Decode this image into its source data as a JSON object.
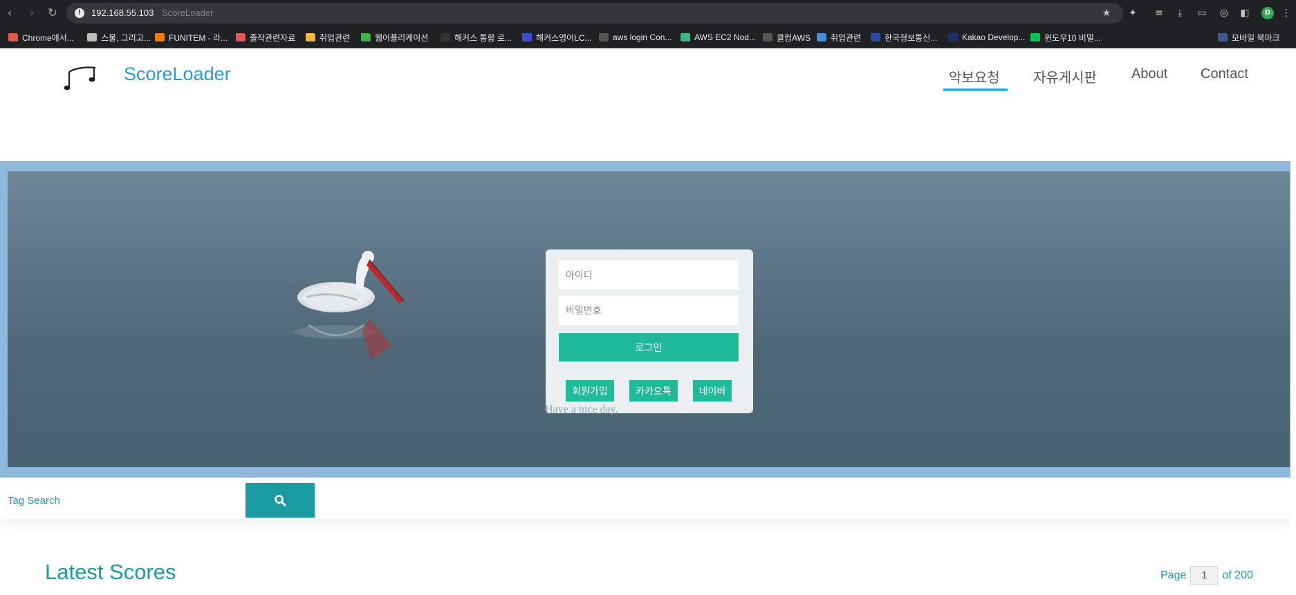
{
  "browser": {
    "url": "192.168.55.103",
    "tab_title": "ScoreLoader",
    "profile_initial": "D",
    "bookmarks": [
      {
        "label": "Chrome에서...",
        "icon": "folder-icon",
        "color": "#e0594f"
      },
      {
        "label": "스물, 그리고...",
        "icon": "dots-icon",
        "color": "#bdbdbd"
      },
      {
        "label": "FUNITEM - 라...",
        "icon": "blogger-icon",
        "color": "#f57d00"
      },
      {
        "label": "졸작관련자료",
        "icon": "folder-icon",
        "color": "#e0594f"
      },
      {
        "label": "취업관련",
        "icon": "folder-icon",
        "color": "#f6b83d"
      },
      {
        "label": "웹어플리케이션",
        "icon": "folder-icon",
        "color": "#3bb54a"
      },
      {
        "label": "해커스 통합 로...",
        "icon": "hackers-icon",
        "color": "#333333"
      },
      {
        "label": "해커스영어LC...",
        "icon": "h-icon",
        "color": "#3c4ecc"
      },
      {
        "label": "aws login Con...",
        "icon": "aws-icon",
        "color": "#555555"
      },
      {
        "label": "AWS EC2 Nod...",
        "icon": "v-icon",
        "color": "#41b883"
      },
      {
        "label": "클컴AWS",
        "icon": "aws-icon",
        "color": "#555555"
      },
      {
        "label": "취업관련",
        "icon": "folder-icon",
        "color": "#4a90d9"
      },
      {
        "label": "한국정보통신...",
        "icon": "kica-icon",
        "color": "#2a4ea0"
      },
      {
        "label": "Kakao Develop...",
        "icon": "k-icon",
        "color": "#1c2f6e"
      },
      {
        "label": "윈도우10 비밀...",
        "icon": "line-icon",
        "color": "#06c755"
      }
    ],
    "mobile_bookmarks": "모바일 북마크"
  },
  "header": {
    "brand": "ScoreLoader",
    "menu": [
      {
        "label": "악보요청",
        "active": true
      },
      {
        "label": "자유게시판",
        "active": false
      },
      {
        "label": "About",
        "active": false
      },
      {
        "label": "Contact",
        "active": false
      }
    ]
  },
  "login": {
    "id_placeholder": "아이디",
    "password_placeholder": "비밀번호",
    "login_button": "로그인",
    "signup_button": "회원가입",
    "kakao_button": "카카오톡",
    "naver_button": "네이버",
    "greeting": "Have a nice day."
  },
  "search": {
    "placeholder": "Tag Search"
  },
  "latest": {
    "title": "Latest Scores",
    "page_label": "Page",
    "page_current": "1",
    "page_total_label": "of 200"
  },
  "colors": {
    "accent": "#1fba9a",
    "brand": "#2a9ad1",
    "teal": "#1a9ba1",
    "menu_underline": "#2bb4de"
  }
}
